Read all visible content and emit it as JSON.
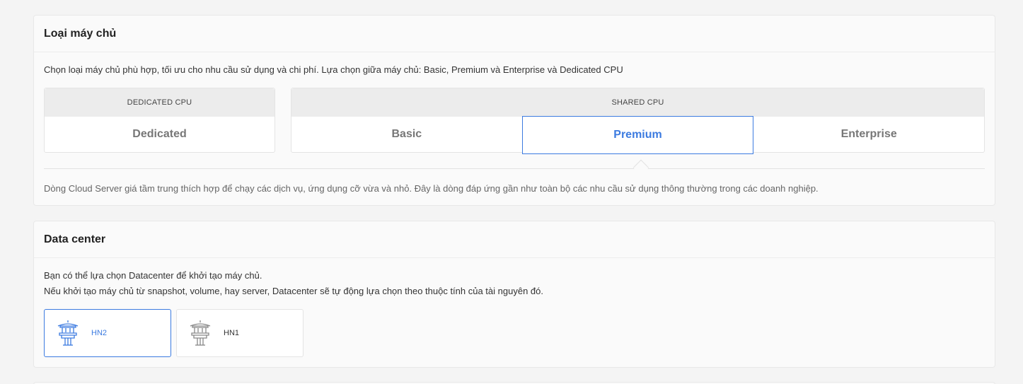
{
  "server_type": {
    "title": "Loại máy chủ",
    "description": "Chọn loại máy chủ phù hợp, tối ưu cho nhu cầu sử dụng và chi phí. Lựa chọn giữa máy chủ: Basic, Premium và Enterprise và Dedicated CPU",
    "groups": [
      {
        "heading": "DEDICATED CPU",
        "options": [
          "Dedicated"
        ]
      },
      {
        "heading": "SHARED CPU",
        "options": [
          "Basic",
          "Premium",
          "Enterprise"
        ]
      }
    ],
    "selected": "Premium",
    "selected_description": "Dòng Cloud Server giá tầm trung thích hợp để chạy các dịch vụ, ứng dụng cỡ vừa và nhỏ. Đây là dòng đáp ứng gần như toàn bộ các nhu cầu sử dụng thông thường trong các doanh nghiệp."
  },
  "datacenter": {
    "title": "Data center",
    "description_line1": "Bạn có thể lựa chọn Datacenter để khởi tạo máy chủ.",
    "description_line2": "Nếu khởi tạo máy chủ từ snapshot, volume, hay server, Datacenter sẽ tự động lựa chọn theo thuộc tính của tài nguyên đó.",
    "options": [
      {
        "label": "HN2",
        "icon": "pagoda-icon"
      },
      {
        "label": "HN1",
        "icon": "pagoda-icon"
      }
    ],
    "selected": "HN2"
  },
  "colors": {
    "accent": "#3c7be0",
    "icon_inactive": "#888888"
  }
}
